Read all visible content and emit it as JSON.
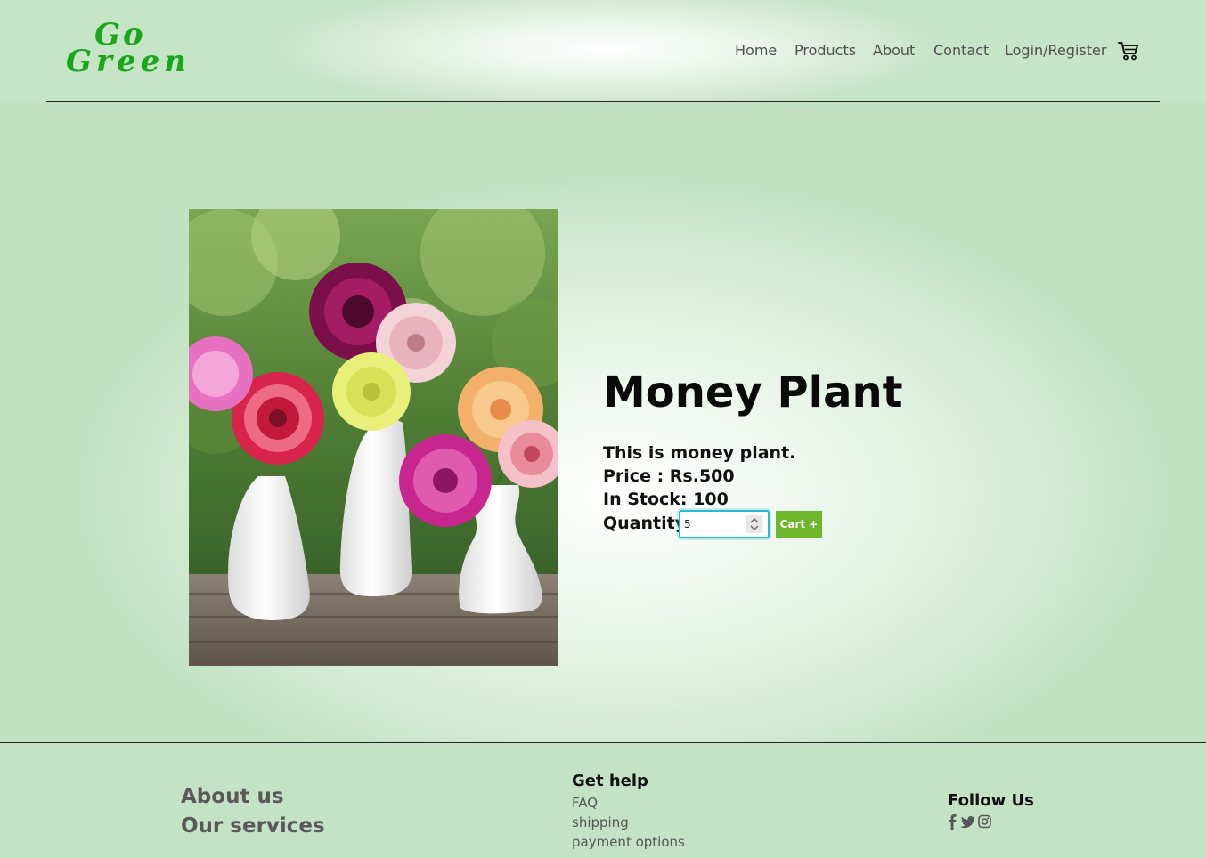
{
  "brand": {
    "logo_line1": "Go",
    "logo_line2": "Green",
    "color": "#1aa61a"
  },
  "nav": {
    "items": [
      {
        "label": "Home"
      },
      {
        "label": "Products"
      },
      {
        "label": "About"
      },
      {
        "label": "Contact"
      },
      {
        "label": "Login/Register"
      }
    ],
    "cart_icon": "shopping-cart-icon"
  },
  "product": {
    "title": "Money Plant",
    "description": "This is money plant.",
    "price": "Price : Rs.500",
    "stock": "In Stock: 100",
    "quantity_label": "Quantity:",
    "quantity_value": "5",
    "add_button_label": "Cart +",
    "button_color": "#6fb62f",
    "image_icon": "flower-vases-photo"
  },
  "footer": {
    "about_label": "About us",
    "services_label": "Our services",
    "help": {
      "heading": "Get help",
      "links": [
        {
          "label": "FAQ"
        },
        {
          "label": "shipping"
        },
        {
          "label": "payment options"
        }
      ]
    },
    "follow": {
      "heading": "Follow Us",
      "icons": [
        "facebook-icon",
        "twitter-icon",
        "instagram-icon"
      ]
    }
  }
}
